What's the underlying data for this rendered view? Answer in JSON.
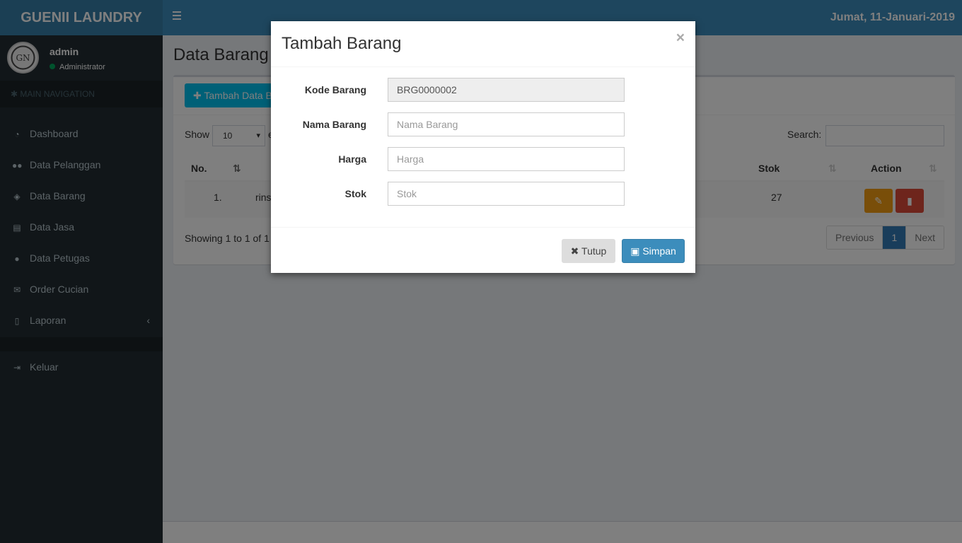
{
  "app": {
    "logo_text": "GUENII LAUNDRY",
    "date_text": "Jumat, 11-Januari-2019"
  },
  "user": {
    "name": "admin",
    "role": "Administrator"
  },
  "sidebar": {
    "header": "MAIN NAVIGATION",
    "items": [
      {
        "label": "Dashboard",
        "icon": "dashboard-icon"
      },
      {
        "label": "Data Pelanggan",
        "icon": "users-icon"
      },
      {
        "label": "Data Barang",
        "icon": "cube-icon"
      },
      {
        "label": "Data Jasa",
        "icon": "file-icon"
      },
      {
        "label": "Data Petugas",
        "icon": "user-icon"
      },
      {
        "label": "Order Cucian",
        "icon": "envelope-icon"
      },
      {
        "label": "Laporan",
        "icon": "file-outline-icon"
      }
    ],
    "logout": "Keluar"
  },
  "page": {
    "title": "Data Barang",
    "add_button": "Tambah Data Barang",
    "show_label": "Show",
    "show_value": "10",
    "show_suffix": "e",
    "search_label": "Search:",
    "table": {
      "columns": [
        "No.",
        "Stok",
        "Action"
      ],
      "rows": [
        {
          "no": "1.",
          "name": "rins",
          "stok": "27"
        }
      ]
    },
    "showing": "Showing 1 to 1 of 1",
    "pager": {
      "previous": "Previous",
      "current": "1",
      "next": "Next"
    }
  },
  "modal": {
    "title": "Tambah Barang",
    "close": "×",
    "fields": {
      "kode": {
        "label": "Kode Barang",
        "value": "BRG0000002"
      },
      "nama": {
        "label": "Nama Barang",
        "placeholder": "Nama Barang"
      },
      "harga": {
        "label": "Harga",
        "placeholder": "Harga"
      },
      "stok": {
        "label": "Stok",
        "placeholder": "Stok"
      }
    },
    "buttons": {
      "tutup": "Tutup",
      "simpan": "Simpan"
    }
  },
  "colors": {
    "header": "#3c8dbc",
    "logo": "#367fa9",
    "sidebar": "#222d32",
    "primary_button": "#3c8dbc",
    "edit_button": "#f39c12",
    "delete_button": "#dd4b39"
  }
}
